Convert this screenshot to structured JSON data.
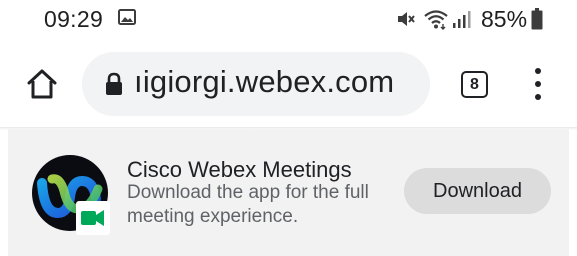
{
  "status_bar": {
    "time": "09:29",
    "battery_percent": "85%",
    "icons": [
      "gallery-icon",
      "mute-icon",
      "wifi-icon",
      "signal-icon",
      "battery-icon"
    ]
  },
  "toolbar": {
    "url": "ıigiorgi.webex.com",
    "tab_count": "8",
    "icons": [
      "home-icon",
      "lock-icon",
      "tab-switcher-icon",
      "more-menu-icon"
    ]
  },
  "banner": {
    "app_name": "Cisco Webex Meetings",
    "description": "Download the app for the full meeting experience.",
    "download_label": "Download",
    "icon": "webex-app-icon"
  },
  "colors": {
    "banner_background": "#f2f2f2",
    "omnibox_background": "#f1f3f4",
    "button_background": "#dcdcdc",
    "webex_green": "#00a85a",
    "webex_blue": "#1d6ff3"
  }
}
